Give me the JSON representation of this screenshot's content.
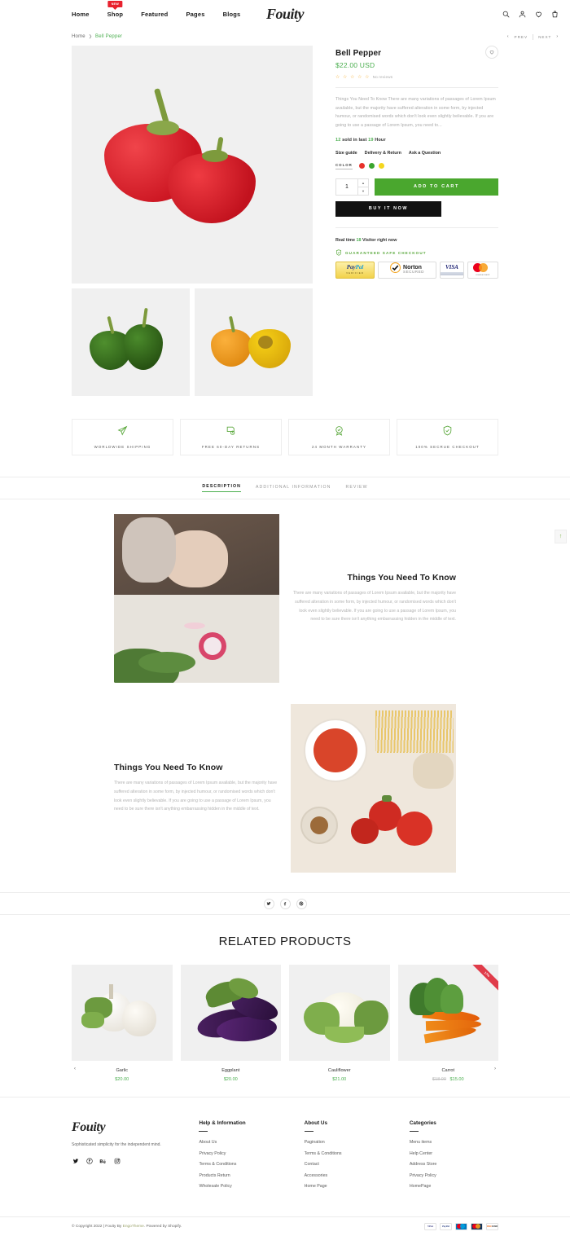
{
  "header": {
    "nav": [
      {
        "label": "Home",
        "badge": null
      },
      {
        "label": "Shop",
        "badge": "NEW"
      },
      {
        "label": "Featured",
        "badge": null
      },
      {
        "label": "Pages",
        "badge": null
      },
      {
        "label": "Blogs",
        "badge": null
      }
    ],
    "brand": "Fouity",
    "icons": [
      "search-icon",
      "account-icon",
      "wishlist-icon",
      "cart-icon"
    ]
  },
  "breadcrumb": {
    "home": "Home",
    "separator": "❯",
    "current": "Bell Pepper",
    "prev": "PREV",
    "next": "NEXT"
  },
  "product": {
    "title": "Bell Pepper",
    "price": "$22.00 USD",
    "stars": "☆ ☆ ☆ ☆ ☆",
    "reviews": "No reviews",
    "description": "Things You Need To Know There are many variations of passages of Lorem Ipsum available, but the majority have suffered alteration in some form, by injected humour, or randomised words which don't look even slightly believable. If you are going to use a passage of Lorem Ipsum, you need to...",
    "sold_count": "12",
    "sold_text_a": "sold in last",
    "sold_hours": "19",
    "sold_text_b": "Hour",
    "meta_links": [
      "Size guide",
      "Delivery & Return",
      "Ask a Question"
    ],
    "color_label": "COLOR",
    "colors": [
      "#e8312b",
      "#3aa52e",
      "#f4d61e"
    ],
    "quantity": "1",
    "add_to_cart": "ADD TO CART",
    "buy_now": "BUY IT NOW",
    "realtime_a": "Real time",
    "realtime_num": "18",
    "realtime_b": "Visitor right now",
    "safe_checkout": "GUARANTEED SAFE CHECKOUT",
    "payments": [
      "PayPal VERIFIED",
      "Norton SECURED",
      "VISA",
      "MasterCard"
    ],
    "accent_green": "#4caf50",
    "cart_green": "#4aa72e"
  },
  "features": [
    {
      "icon": "plane-icon",
      "label": "WORLDWIDE SHIPPING"
    },
    {
      "icon": "return-box-icon",
      "label": "FREE 60-DAY RETURNS"
    },
    {
      "icon": "warranty-badge-icon",
      "label": "24 MONTH WARRANTY"
    },
    {
      "icon": "shield-check-icon",
      "label": "100% SECRUE CHECKOUT"
    }
  ],
  "tabs": [
    {
      "label": "DESCRIPTION",
      "active": true
    },
    {
      "label": "ADDITIONAL INFORMATION",
      "active": false
    },
    {
      "label": "REVIEW",
      "active": false
    }
  ],
  "description_blocks": [
    {
      "heading": "Things You Need To Know",
      "body": "There are many variations of passages of Lorem Ipsum available, but the majority have suffered alteration in some form, by injected humour, or randomised words which don't look even slightly believable. If you are going to use a passage of Lorem Ipsum, you need to be sure there isn't anything embarrassing hidden in the middle of text.",
      "image": "hands-cutting-radish"
    },
    {
      "heading": "Things You Need To Know",
      "body": "There are many variations of passages of Lorem Ipsum available, but the majority have suffered alteration in some form, by injected humour, or randomised words which don't look even slightly believable. If you are going to use a passage of Lorem Ipsum, you need to be sure there isn't anything embarrassing hidden in the middle of text.",
      "image": "tomato-soup-pasta"
    }
  ],
  "share": [
    "twitter-icon",
    "facebook-icon",
    "pinterest-icon"
  ],
  "related": {
    "title": "RELATED PRODUCTS",
    "prev_arrow": "‹",
    "next_arrow": "›",
    "products": [
      {
        "name": "Garlic",
        "price": "$20.00",
        "old_price": null,
        "badge": null
      },
      {
        "name": "Eggplant",
        "price": "$20.00",
        "old_price": null,
        "badge": null
      },
      {
        "name": "Cauliflower",
        "price": "$21.00",
        "old_price": null,
        "badge": null
      },
      {
        "name": "Carrot",
        "price": "$15.00",
        "old_price": "$18.00",
        "badge": "17%"
      }
    ]
  },
  "footer": {
    "logo": "Fouity",
    "tagline": "Sophisticated simplicity for the independent mind.",
    "social": [
      "twitter-icon",
      "pinterest-icon",
      "behance-icon",
      "instagram-icon"
    ],
    "columns": [
      {
        "title": "Help & Information",
        "links": [
          "About Us",
          "Privacy Policy",
          "Terms & Conditions",
          "Products Return",
          "Wholesale Policy"
        ]
      },
      {
        "title": "About Us",
        "links": [
          "Pagination",
          "Terms & Conditions",
          "Contact",
          "Accessories",
          "Home Page"
        ]
      },
      {
        "title": "Categories",
        "links": [
          "Menu items",
          "Help Center",
          "Address Store",
          "Privacy Policy",
          "HomePage"
        ]
      }
    ]
  },
  "copyright": {
    "text_before": "© Copyright 2022 | Fouity By ",
    "engo": "EngoTheme",
    "text_after": ". Powered by Shopify.",
    "cards": [
      "VISA",
      "PayPal",
      "Maestro",
      "MasterCard",
      "Discover"
    ]
  },
  "scrolltop": {
    "icon": "arrow-up-icon"
  }
}
